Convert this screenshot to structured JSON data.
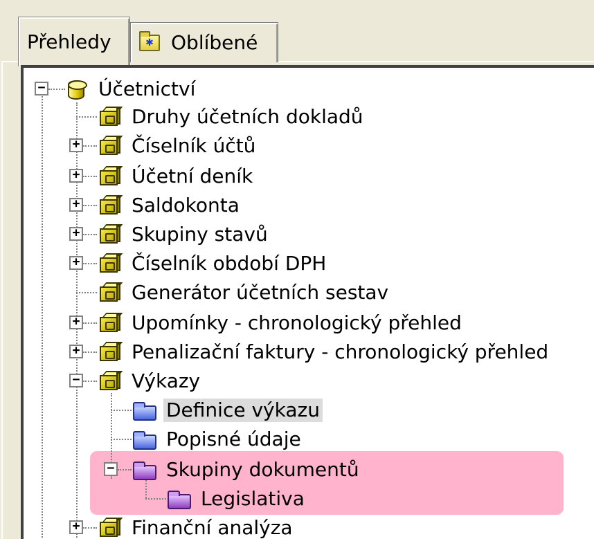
{
  "tabs": [
    {
      "label": "Přehledy",
      "active": true
    },
    {
      "label": "Oblíbené",
      "active": false,
      "icon": "favorites-folder-icon"
    }
  ],
  "tree": {
    "root": {
      "label": "Účetnictví",
      "icon": "database-icon",
      "expanded": true
    },
    "items": [
      {
        "label": "Druhy účetních dokladů",
        "icon": "module-book-icon",
        "toggle": ""
      },
      {
        "label": "Číselník účtů",
        "icon": "module-book-icon",
        "toggle": "+"
      },
      {
        "label": "Účetní deník",
        "icon": "module-book-icon",
        "toggle": "+"
      },
      {
        "label": "Saldokonta",
        "icon": "module-book-icon",
        "toggle": "+"
      },
      {
        "label": "Skupiny stavů",
        "icon": "module-book-icon",
        "toggle": "+"
      },
      {
        "label": "Číselník období DPH",
        "icon": "module-book-icon",
        "toggle": "+"
      },
      {
        "label": "Generátor účetních sestav",
        "icon": "module-book-icon",
        "toggle": ""
      },
      {
        "label": "Upomínky - chronologický přehled",
        "icon": "module-book-icon",
        "toggle": "+"
      },
      {
        "label": "Penalizační faktury - chronologický přehled",
        "icon": "module-book-icon",
        "toggle": "+"
      },
      {
        "label": "Výkazy",
        "icon": "module-book-icon",
        "toggle": "−"
      },
      {
        "label": "Definice výkazu",
        "icon": "blue-folder-icon",
        "toggle": "",
        "selected": true
      },
      {
        "label": "Popisné údaje",
        "icon": "blue-folder-icon",
        "toggle": ""
      },
      {
        "label": "Skupiny dokumentů",
        "icon": "purple-folder-icon",
        "toggle": "−",
        "highlighted": true
      },
      {
        "label": "Legislativa",
        "icon": "purple-folder-icon",
        "toggle": "",
        "highlighted": true
      },
      {
        "label": "Finanční analýza",
        "icon": "module-book-icon",
        "toggle": "+"
      }
    ]
  },
  "colors": {
    "highlight": "#ffb3cc",
    "selected": "#dcdcdc"
  }
}
